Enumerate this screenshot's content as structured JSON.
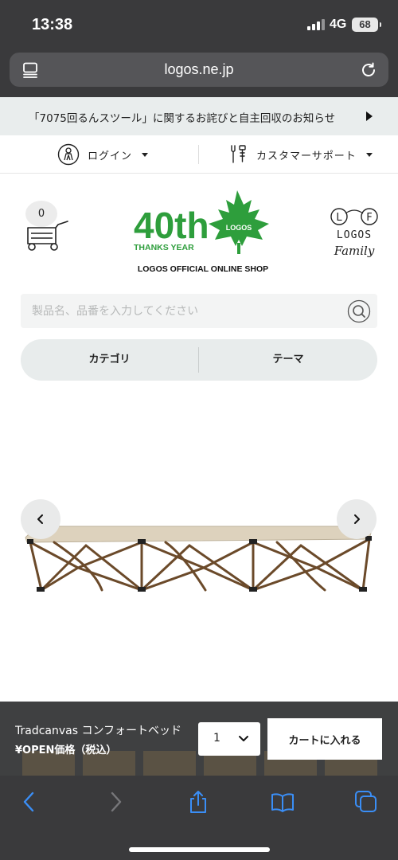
{
  "status_bar": {
    "time": "13:38",
    "network": "4G",
    "battery": "68"
  },
  "browser": {
    "url": "logos.ne.jp"
  },
  "notice": {
    "text": "「7075回るんスツール」に関するお詫びと自主回収のお知らせ"
  },
  "utility": {
    "login_label": "ログイン",
    "support_label": "カスタマーサポート"
  },
  "header": {
    "cart_count": "0",
    "logo_anniversary": "40th",
    "logo_thanks": "THANKS YEAR",
    "logo_brand": "LOGOS",
    "logo_caption": "LOGOS OFFICIAL ONLINE SHOP",
    "family_letters": [
      "L",
      "F"
    ],
    "family_brand": "LOGOS",
    "family_word": "Family"
  },
  "search": {
    "placeholder": "製品名、品番を入力してください"
  },
  "nav": {
    "category_label": "カテゴリ",
    "theme_label": "テーマ"
  },
  "purchase": {
    "product_name": "Tradcanvas コンフォートベッド",
    "price_label": "¥OPEN価格（税込）",
    "quantity": "1",
    "add_to_cart_label": "カートに入れる"
  },
  "colors": {
    "accent_green": "#2e9e3c",
    "dark_chrome": "#3a3a3c",
    "cot_fabric": "#ddd2bd",
    "cot_frame": "#6b4a2a"
  }
}
